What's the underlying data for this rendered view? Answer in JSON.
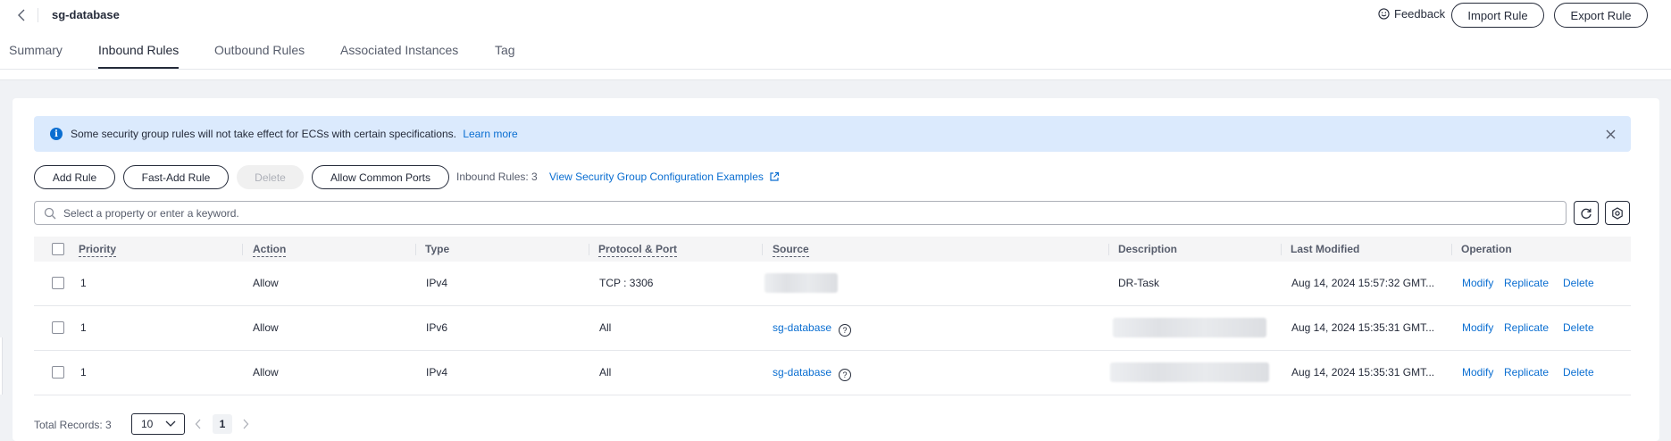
{
  "header": {
    "title": "sg-database",
    "feedback_label": "Feedback",
    "import_label": "Import Rule",
    "export_label": "Export Rule"
  },
  "tabs": [
    {
      "label": "Summary",
      "active": false
    },
    {
      "label": "Inbound Rules",
      "active": true
    },
    {
      "label": "Outbound Rules",
      "active": false
    },
    {
      "label": "Associated Instances",
      "active": false
    },
    {
      "label": "Tag",
      "active": false
    }
  ],
  "alert": {
    "text": "Some security group rules will not take effect for ECSs with certain specifications.",
    "link": "Learn more"
  },
  "toolbar": {
    "add_rule": "Add Rule",
    "fast_add_rule": "Fast-Add Rule",
    "delete": "Delete",
    "allow_common_ports": "Allow Common Ports",
    "rules_count": "Inbound Rules: 3",
    "examples_link": "View Security Group Configuration Examples"
  },
  "search": {
    "placeholder": "Select a property or enter a keyword."
  },
  "table": {
    "columns": [
      "Priority",
      "Action",
      "Type",
      "Protocol & Port",
      "Source",
      "Description",
      "Last Modified",
      "Operation"
    ],
    "rows": [
      {
        "priority": "1",
        "action": "Allow",
        "type": "IPv4",
        "protocol_port": "TCP : 3306",
        "source": "",
        "description": "DR-Task",
        "last_modified": "Aug 14, 2024 15:57:32 GMT...",
        "operations": [
          "Modify",
          "Replicate",
          "Delete"
        ]
      },
      {
        "priority": "1",
        "action": "Allow",
        "type": "IPv6",
        "protocol_port": "All",
        "source": "sg-database",
        "description": "",
        "last_modified": "Aug 14, 2024 15:35:31 GMT...",
        "operations": [
          "Modify",
          "Replicate",
          "Delete"
        ]
      },
      {
        "priority": "1",
        "action": "Allow",
        "type": "IPv4",
        "protocol_port": "All",
        "source": "sg-database",
        "description": "",
        "last_modified": "Aug 14, 2024 15:35:31 GMT...",
        "operations": [
          "Modify",
          "Replicate",
          "Delete"
        ]
      }
    ]
  },
  "pagination": {
    "total": "Total Records: 3",
    "page_size": "10",
    "current_page": "1"
  },
  "colors": {
    "link": "#0a6ed1",
    "alert_bg": "#dbeafd",
    "text": "#252b3a"
  }
}
